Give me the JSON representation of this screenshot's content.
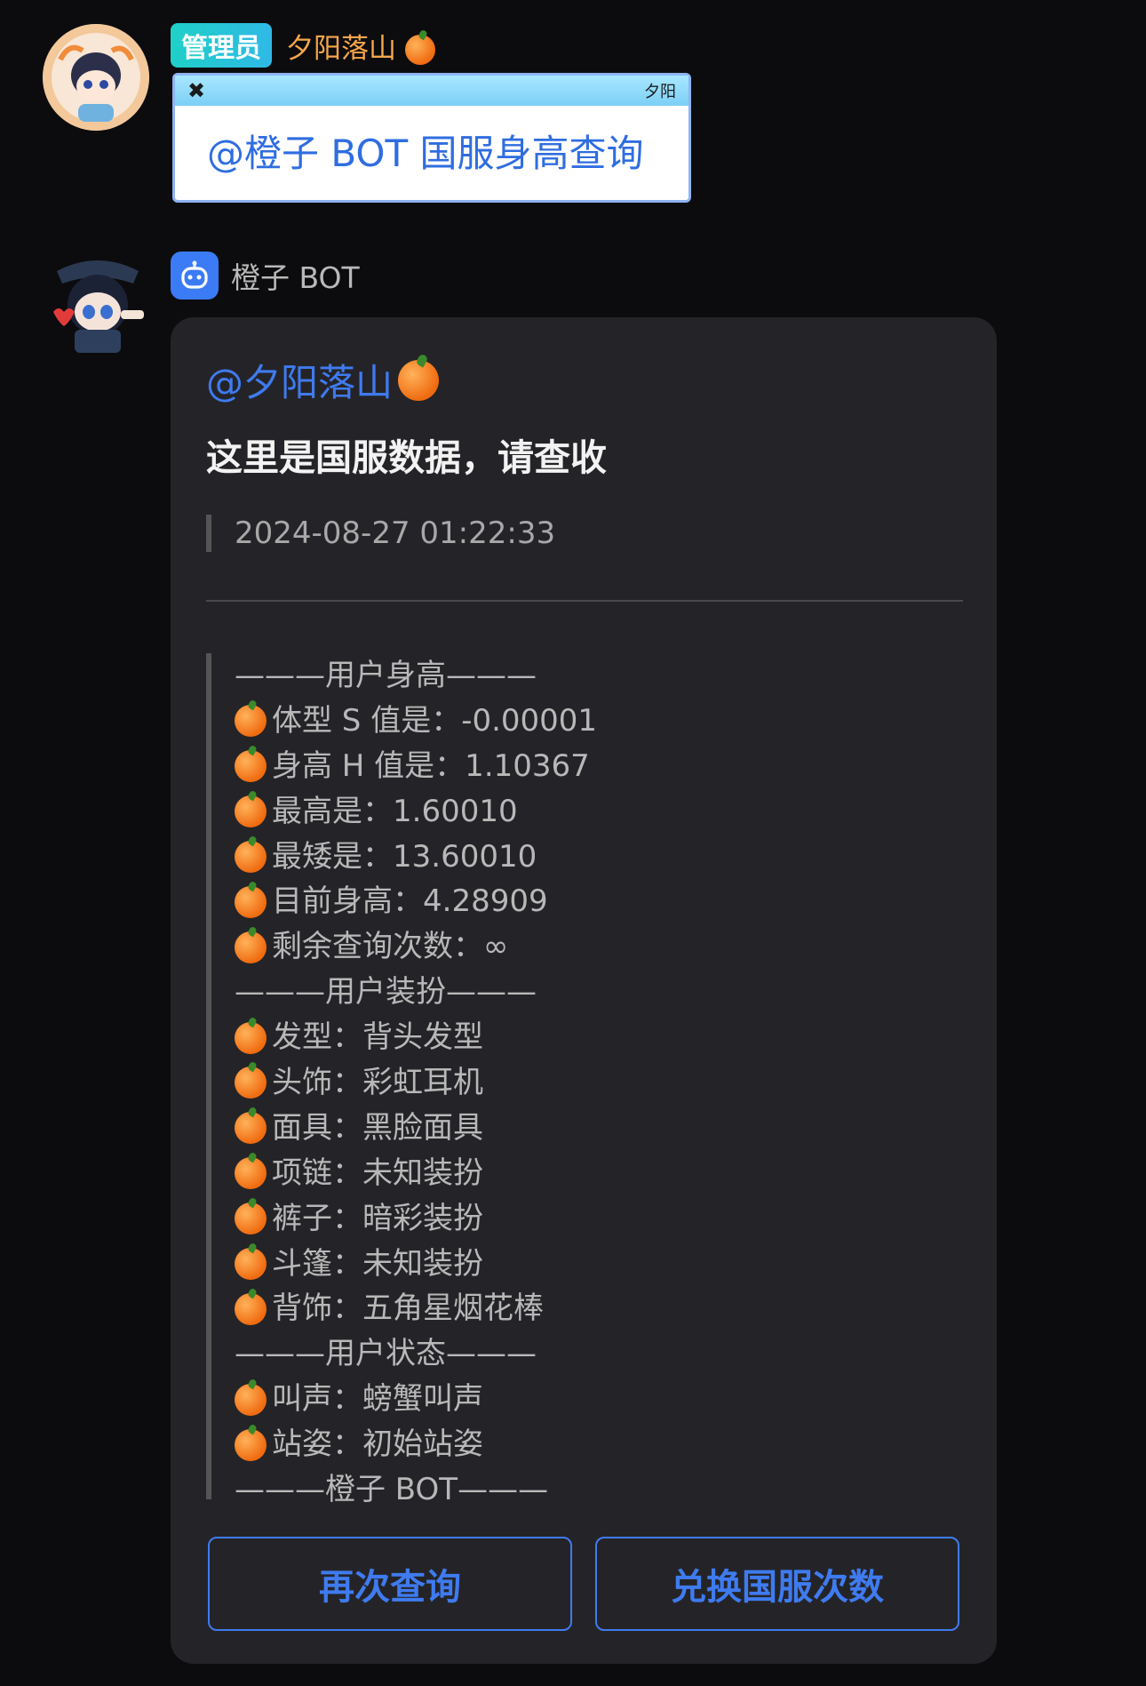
{
  "admin_message": {
    "badge": "管理员",
    "username": "夕阳落山",
    "bubble_tag": "夕阳",
    "text": "@橙子 BOT 国服身高查询"
  },
  "bot_message": {
    "name": "橙子 BOT",
    "mention": "@夕阳落山",
    "headline": "这里是国服数据，请查收",
    "timestamp": "2024-08-27 01:22:33",
    "lines": [
      {
        "text": "———用户身高———",
        "orange": false
      },
      {
        "text": "体型 S 值是：-0.00001",
        "orange": true
      },
      {
        "text": "身高 H 值是：1.10367",
        "orange": true
      },
      {
        "text": "最高是：1.60010",
        "orange": true
      },
      {
        "text": "最矮是：13.60010",
        "orange": true
      },
      {
        "text": "目前身高：4.28909",
        "orange": true
      },
      {
        "text": "剩余查询次数：∞",
        "orange": true
      },
      {
        "text": "———用户装扮———",
        "orange": false
      },
      {
        "text": "发型：背头发型",
        "orange": true
      },
      {
        "text": "头饰：彩虹耳机",
        "orange": true
      },
      {
        "text": "面具：黑脸面具",
        "orange": true
      },
      {
        "text": "项链：未知装扮",
        "orange": true
      },
      {
        "text": "裤子：暗彩装扮",
        "orange": true
      },
      {
        "text": "斗篷：未知装扮",
        "orange": true
      },
      {
        "text": "背饰：五角星烟花棒",
        "orange": true
      },
      {
        "text": "———用户状态———",
        "orange": false
      },
      {
        "text": "叫声：螃蟹叫声",
        "orange": true
      },
      {
        "text": "站姿：初始站姿",
        "orange": true
      },
      {
        "text": "———橙子 BOT———",
        "orange": false
      }
    ],
    "buttons": {
      "again": "再次查询",
      "exchange": "兑换国服次数"
    }
  },
  "colors": {
    "background": "#0c0c0e",
    "card": "#242428",
    "accent_blue": "#3f7bf0",
    "admin_name": "#f6a64a"
  }
}
